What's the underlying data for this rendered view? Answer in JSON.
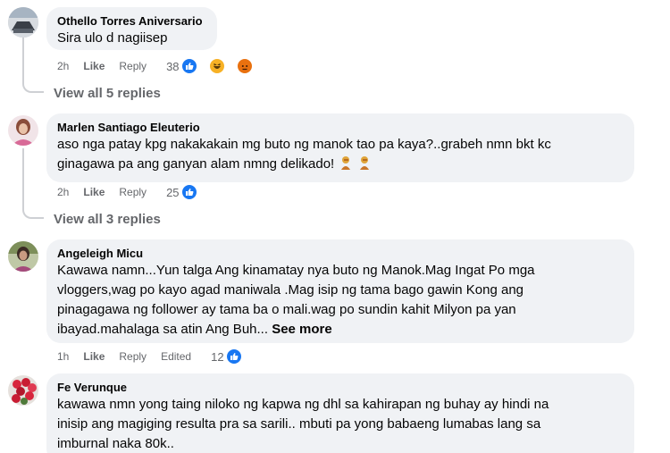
{
  "comments": [
    {
      "author": "Othello Torres Aniversario",
      "text": "Sira ulo d nagiisep",
      "time": "2h",
      "like_label": "Like",
      "reply_label": "Reply",
      "reaction_count": "38",
      "reactions": [
        "like-icon",
        "haha-icon",
        "angry-icon"
      ],
      "view_replies": "View all 5 replies"
    },
    {
      "author": "Marlen Santiago Eleuterio",
      "text_lines": [
        "aso nga patay kpg nakakakain mg buto ng manok tao pa kaya?..grabeh nmn bkt kc",
        "ginagawa pa ang ganyan alam nmng delikado!"
      ],
      "emoji": [
        "person-facepalming-emoji",
        "person-facepalming-emoji"
      ],
      "time": "2h",
      "like_label": "Like",
      "reply_label": "Reply",
      "reaction_count": "25",
      "reactions": [
        "like-icon"
      ],
      "view_replies": "View all 3 replies"
    },
    {
      "author": "Angeleigh Micu",
      "text_lines": [
        "Kawawa namn...Yun talga Ang kinamatay nya buto ng Manok.Mag Ingat Po mga",
        "vloggers,wag po kayo agad maniwala .Mag isip ng tama bago gawin Kong ang",
        "pinagagawa ng follower ay tama ba o mali.wag po sundin kahit Milyon pa yan",
        "ibayad.mahalaga sa atin Ang Buh..."
      ],
      "see_more": "See more",
      "time": "1h",
      "like_label": "Like",
      "reply_label": "Reply",
      "edited_label": "Edited",
      "reaction_count": "12",
      "reactions": [
        "like-icon"
      ]
    },
    {
      "author": "Fe Verunque",
      "text_lines": [
        "kawawa nmn yong taing niloko ng kapwa ng dhl sa kahirapan ng buhay ay hindi na",
        "inisip ang magiging resulta pra sa sarili.. mbuti pa yong babaeng lumabas lang sa",
        "imburnal naka 80k.."
      ]
    }
  ],
  "colors": {
    "bubble": "#f0f2f5",
    "secondary_text": "#65676b",
    "like_blue": "#1877f2"
  }
}
